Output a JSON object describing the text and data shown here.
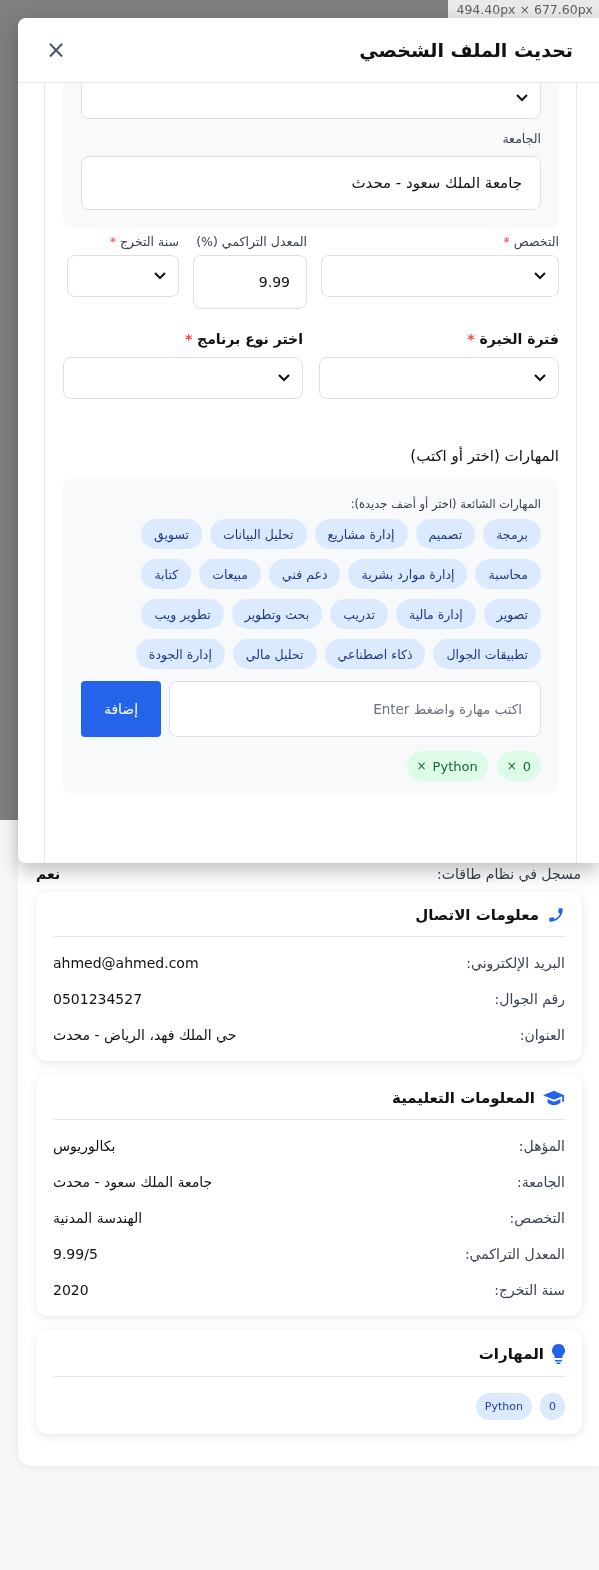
{
  "devtools_size_label": "494.40px × 677.60px",
  "modal": {
    "title": "تحديث الملف الشخصي",
    "close": "×",
    "top_panel": {
      "select": {
        "kind": "select"
      },
      "university": {
        "label": "الجامعة",
        "value": "جامعة الملك سعود - محدث"
      }
    },
    "fields": [
      {
        "kind": "select",
        "label": "التخصص",
        "required_mark": "*"
      },
      {
        "kind": "input",
        "label": "المعدل التراكمي (%)",
        "value": "9.99"
      },
      {
        "kind": "select",
        "label": "سنة التخرج",
        "required_mark": "*"
      }
    ],
    "fields_2": [
      {
        "kind": "select",
        "label": "فترة الخبرة",
        "required_mark": "*"
      },
      {
        "kind": "select",
        "label": "اختر نوع برنامج",
        "required_mark": "*"
      }
    ],
    "skills": {
      "title": "المهارات (اختر أو اكتب)",
      "hint": "المهارات الشائعة (اختر أو أضف جديدة):",
      "suggestions": [
        "برمجة",
        "تصميم",
        "إدارة مشاريع",
        "تحليل البيانات",
        "تسويق",
        "محاسبة",
        "إدارة موارد بشرية",
        "دعم فني",
        "مبيعات",
        "كتابة",
        "تصوير",
        "إدارة مالية",
        "تدريب",
        "بحث وتطوير",
        "تطوير ويب",
        "تطبيقات الجوال",
        "ذكاء اصطناعي",
        "تحليل مالي",
        "إدارة الجودة"
      ],
      "input": {
        "placeholder": "اكتب مهارة واضغط Enter"
      },
      "add_button": "إضافة",
      "selected": [
        {
          "label": "0",
          "remove": "×"
        },
        {
          "label": "Python",
          "remove": "×"
        }
      ]
    }
  },
  "profile": {
    "taqat": {
      "label": "مسجل في نظام طاقات:",
      "value": "نعم"
    },
    "cards": [
      {
        "kind": "contact",
        "title": "معلومات الاتصال",
        "rows": [
          {
            "label": "البريد الإلكتروني:",
            "value": "ahmed@ahmed.com"
          },
          {
            "label": "رقم الجوال:",
            "value": "0501234527"
          },
          {
            "label": "العنوان:",
            "value": "حي الملك فهد، الرياض - محدث"
          }
        ]
      },
      {
        "kind": "education",
        "title": "المعلومات التعليمية",
        "rows": [
          {
            "label": "المؤهل:",
            "value": "بكالوريوس"
          },
          {
            "label": "الجامعة:",
            "value": "جامعة الملك سعود - محدث"
          },
          {
            "label": "التخصص:",
            "value": "الهندسة المدنية"
          },
          {
            "label": "المعدل التراكمي:",
            "value": "9.99/5"
          },
          {
            "label": "سنة التخرج:",
            "value": "2020"
          }
        ]
      },
      {
        "kind": "skills",
        "title": "المهارات",
        "chips": [
          "0",
          "Python"
        ]
      }
    ]
  }
}
